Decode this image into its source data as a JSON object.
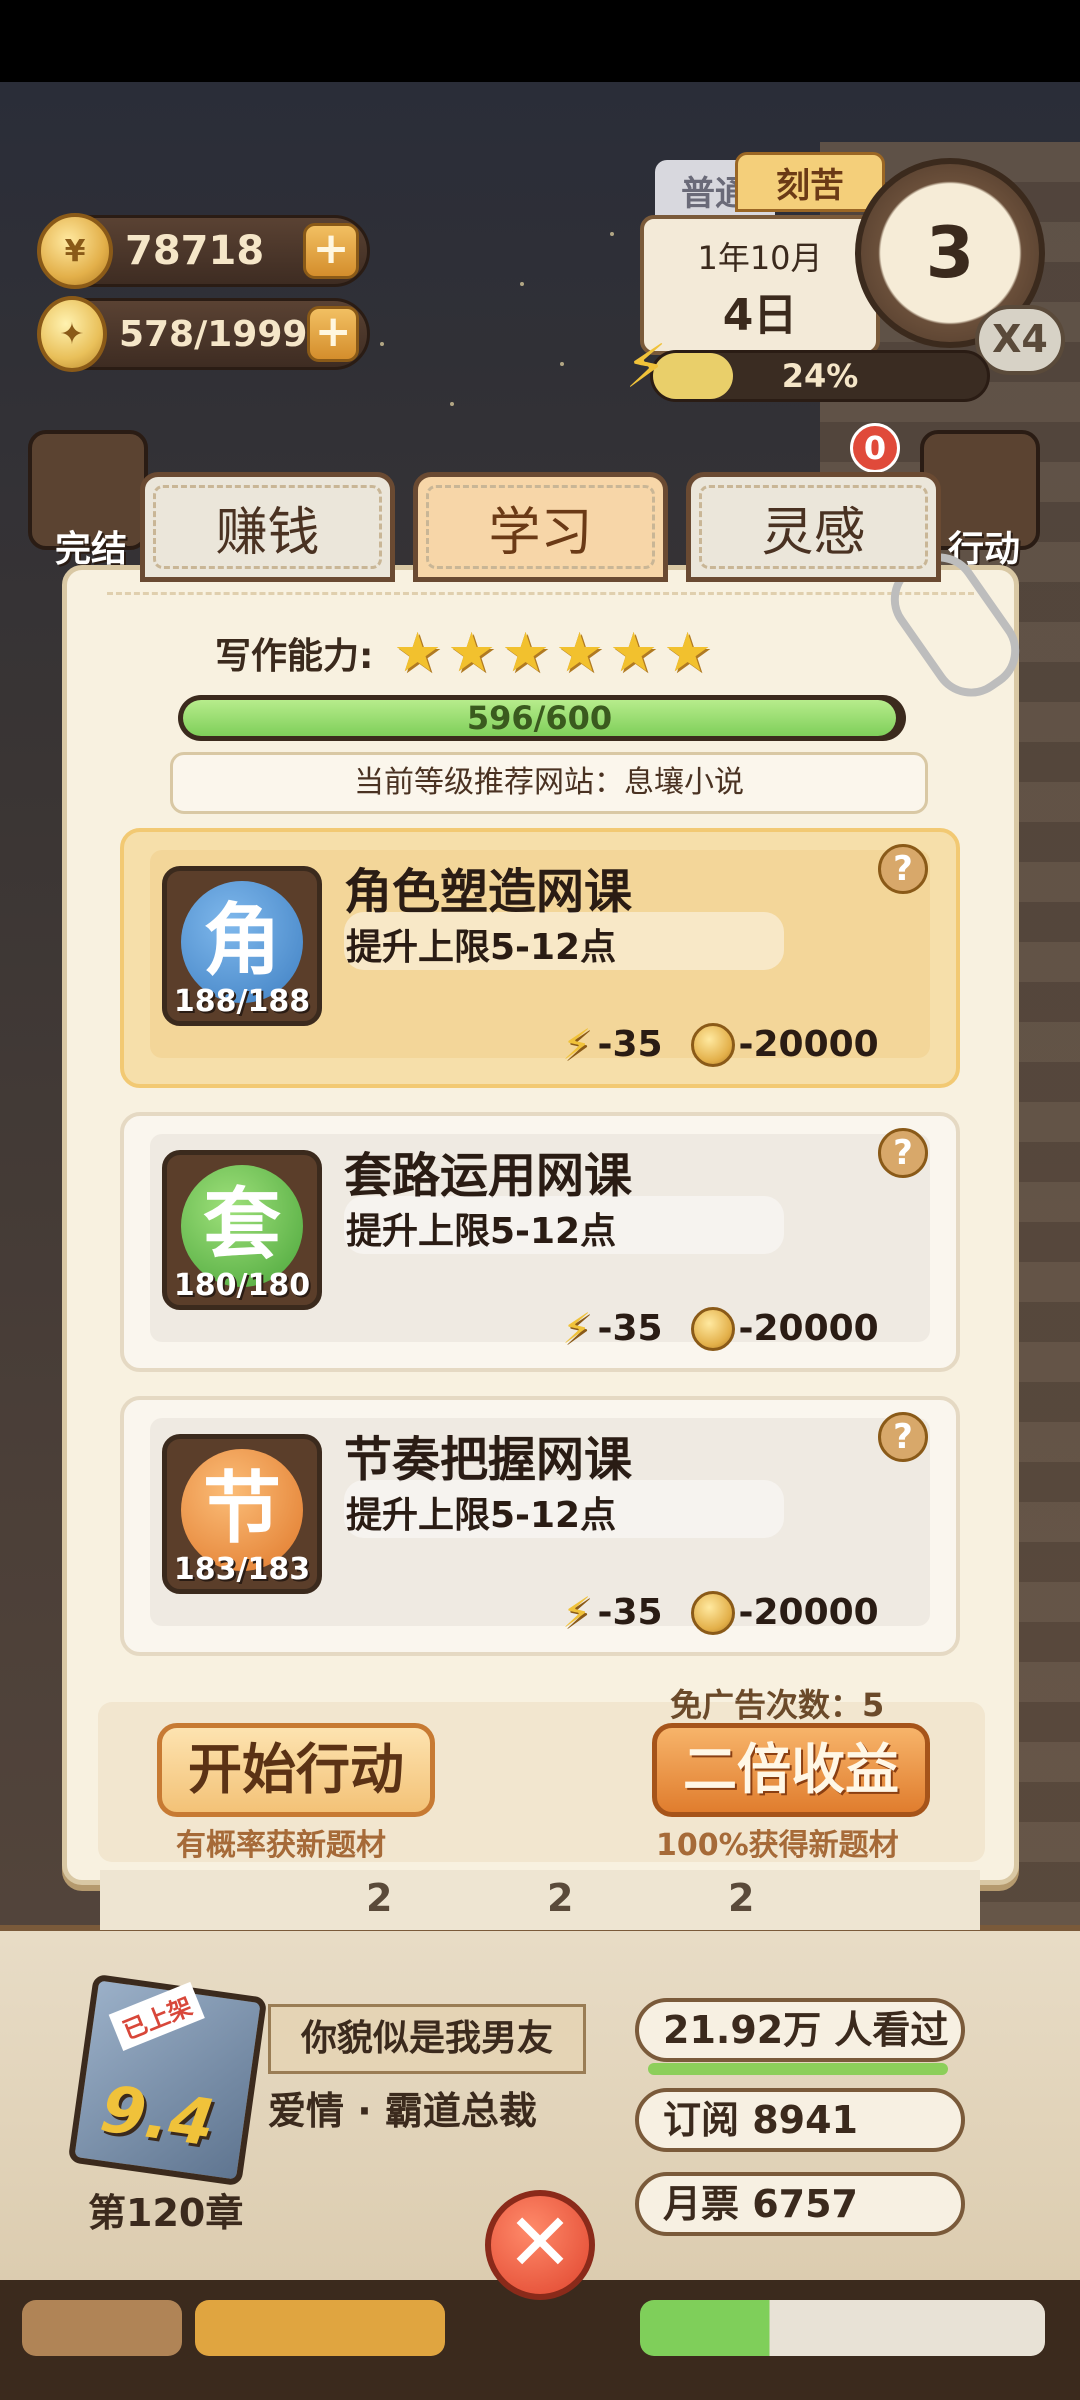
{
  "resources": {
    "coins": "78718",
    "inspiration": "578/1999",
    "plus_symbol": "+"
  },
  "calendar": {
    "mode_normal": "普通",
    "mode_hard": "刻苦",
    "month": "1年10月",
    "day": "4日",
    "clock_value": "3",
    "multiplier": "X4",
    "energy_percent": "24%",
    "energy_fraction": 0.24
  },
  "side": {
    "left_top_label": "完结",
    "right_top_label": "行动",
    "notification_count": "0"
  },
  "tabs": [
    {
      "label": "赚钱",
      "active": false
    },
    {
      "label": "学习",
      "active": true
    },
    {
      "label": "灵感",
      "active": false
    }
  ],
  "panel": {
    "skill_label": "写作能力:",
    "stars": 6,
    "xp_text": "596/600",
    "xp_fraction": 0.993,
    "recommend": "当前等级推荐网站：息壤小说"
  },
  "courses": [
    {
      "icon_char": "角",
      "count": "188/188",
      "title": "角色塑造网课",
      "desc": "提升上限5-12点",
      "energy_cost": "-35",
      "coin_cost": "-20000",
      "selected": true,
      "color": "#4a90d2"
    },
    {
      "icon_char": "套",
      "count": "180/180",
      "title": "套路运用网课",
      "desc": "提升上限5-12点",
      "energy_cost": "-35",
      "coin_cost": "-20000",
      "selected": false,
      "color": "#5cb84a"
    },
    {
      "icon_char": "节",
      "count": "183/183",
      "title": "节奏把握网课",
      "desc": "提升上限5-12点",
      "energy_cost": "-35",
      "coin_cost": "-20000",
      "selected": false,
      "color": "#e98a34"
    }
  ],
  "help_symbol": "?",
  "actions": {
    "ad_free": "免广告次数：5",
    "start_label": "开始行动",
    "start_sub": "有概率获新题材",
    "double_label": "二倍收益",
    "double_sub": "100%获得新题材"
  },
  "strip_numbers": [
    "2",
    "2",
    "2"
  ],
  "book": {
    "status_label": "已上架",
    "score": "9.4",
    "title": "你貌似是我男友",
    "genre": "爱情 · 霸道总裁",
    "chapter": "第120章",
    "views": "21.92万 人看过",
    "subscriptions": "订阅 8941",
    "monthly_votes": "月票 6757"
  },
  "close_symbol": "✕"
}
